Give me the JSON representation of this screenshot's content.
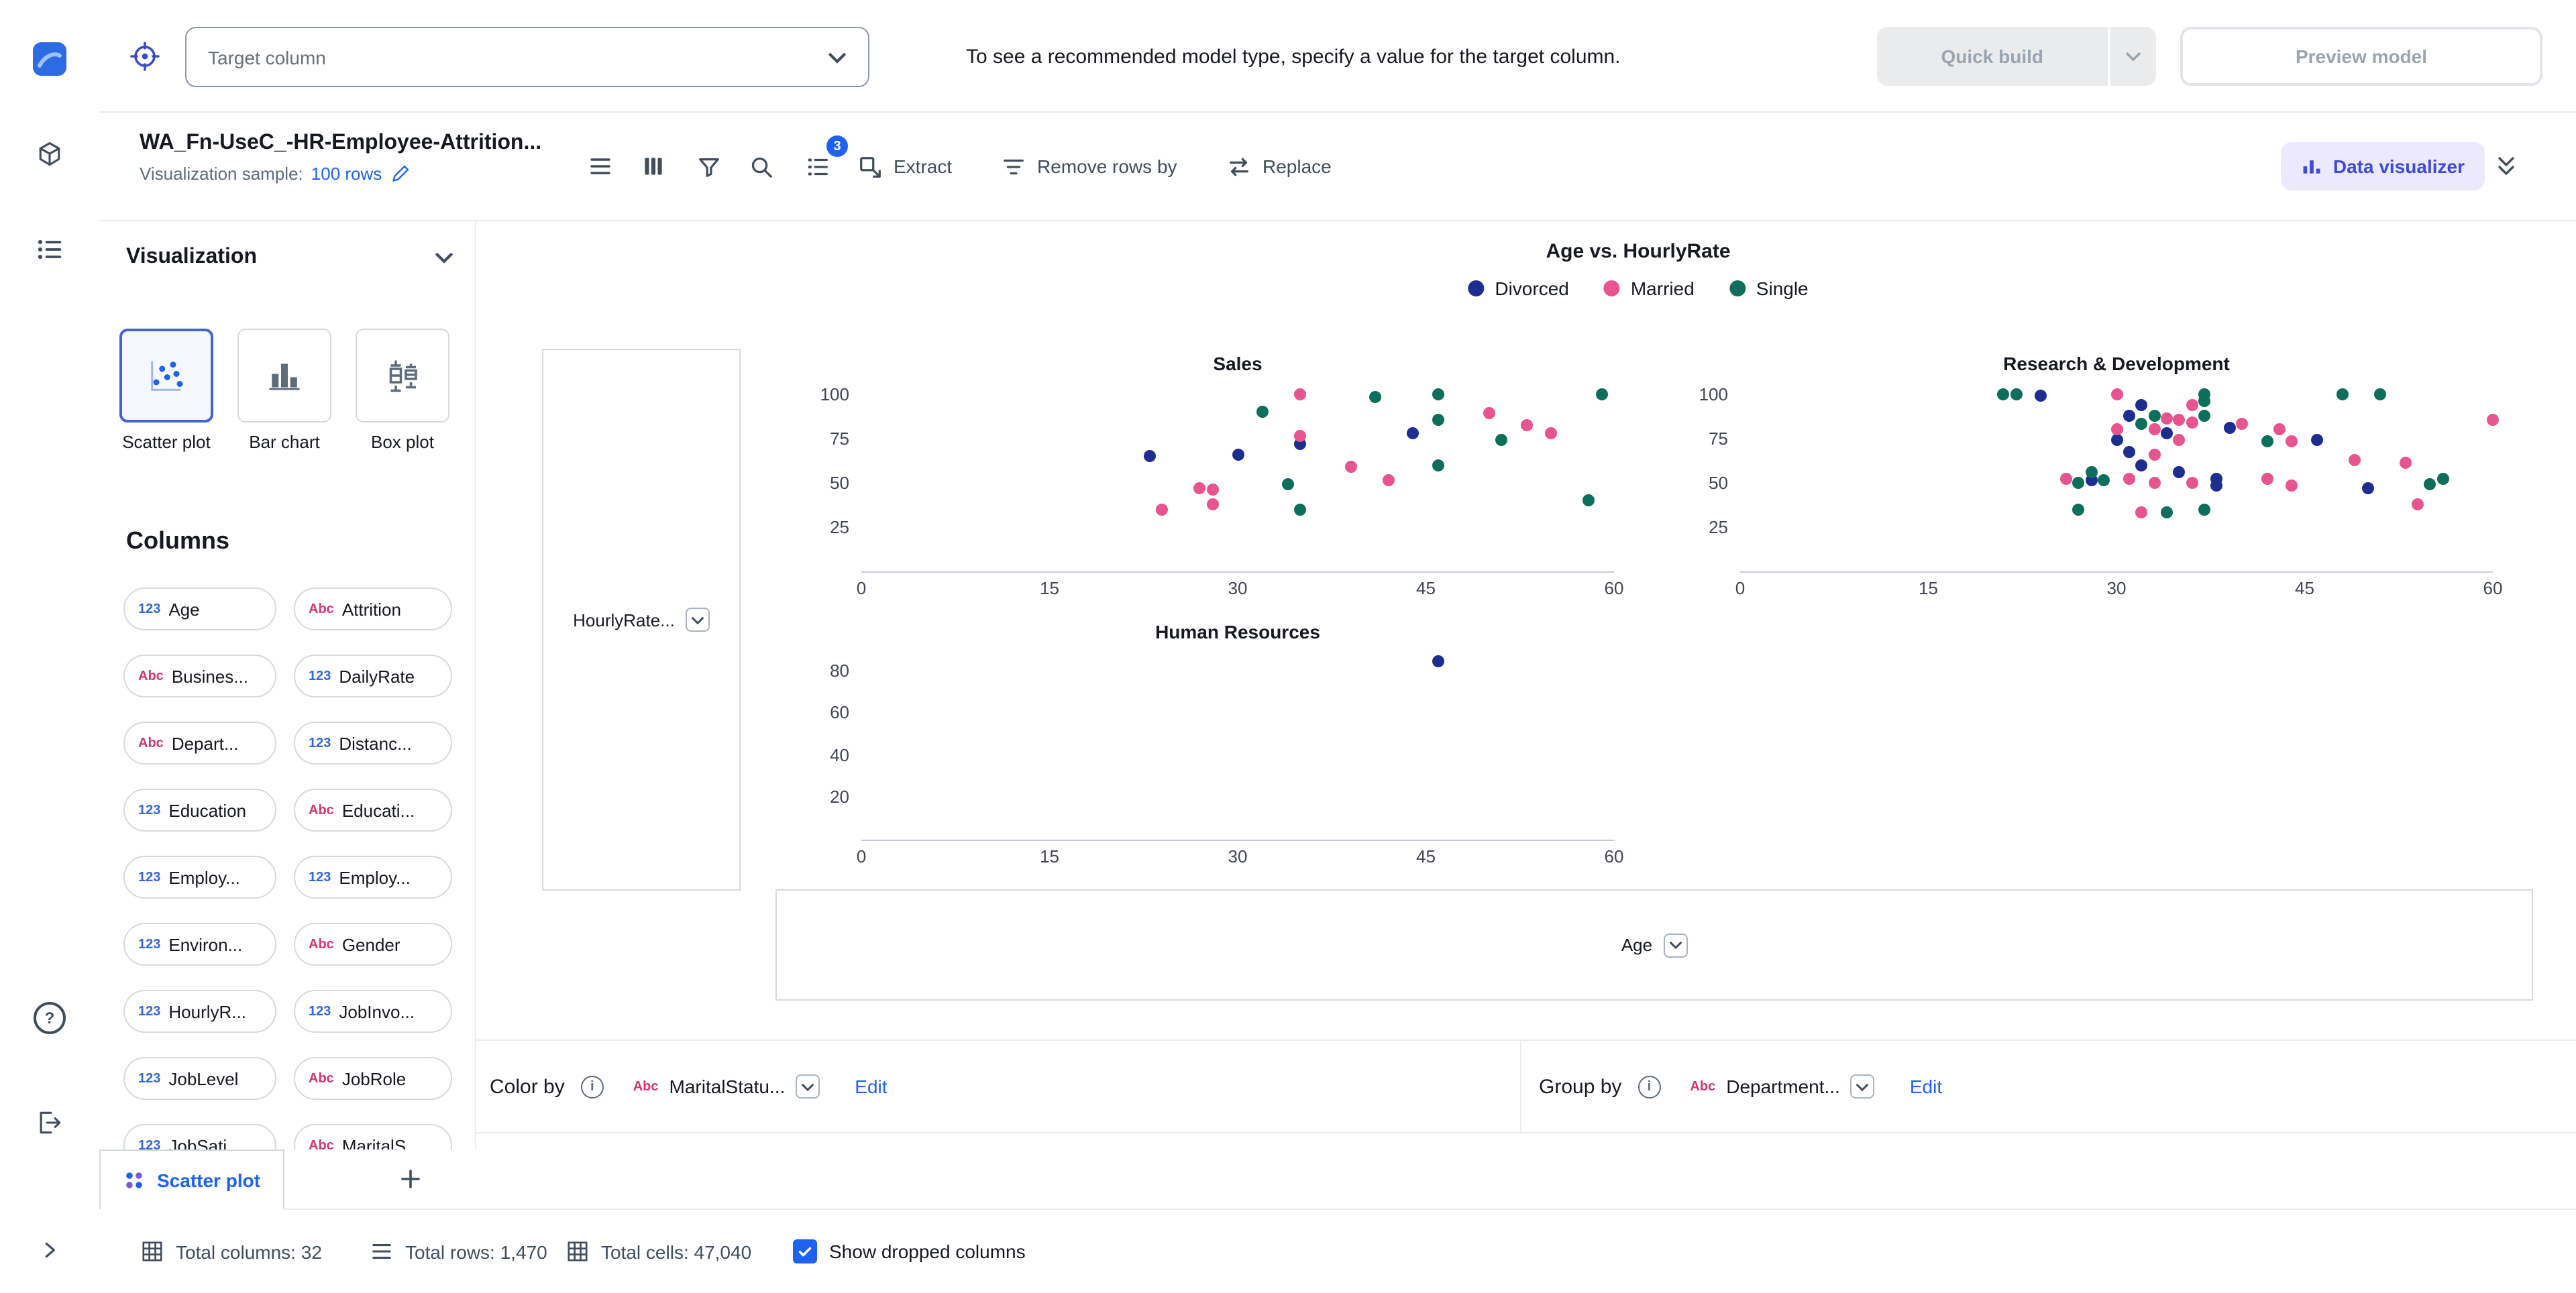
{
  "theme": {
    "accent": "#1d62f0",
    "dv_button_bg": "#ebe9fb",
    "dv_button_text": "#3f4bd8",
    "numeric_badge": "#3366d6",
    "text_badge": "#d13572"
  },
  "icons": {
    "info": "i",
    "help": "?"
  },
  "top_bar": {
    "target_column_placeholder": "Target column",
    "hint": "To see a recommended model type, specify a value for the target column.",
    "quick_build_label": "Quick build",
    "preview_model_label": "Preview model"
  },
  "toolbar": {
    "dataset_title": "WA_Fn-UseC_-HR-Employee-Attrition...",
    "sample_label": "Visualization sample:",
    "sample_value": "100 rows",
    "badge_count": "3",
    "extract_label": "Extract",
    "remove_rows_label": "Remove rows by",
    "replace_label": "Replace",
    "data_visualizer_label": "Data visualizer"
  },
  "viz_panel": {
    "title": "Visualization",
    "chart_types": [
      {
        "label": "Scatter plot",
        "selected": true
      },
      {
        "label": "Bar chart",
        "selected": false
      },
      {
        "label": "Box plot",
        "selected": false
      }
    ],
    "columns_title": "Columns",
    "columns": [
      {
        "type": "123",
        "label": "Age"
      },
      {
        "type": "Abc",
        "label": "Attrition"
      },
      {
        "type": "Abc",
        "label": "Busines..."
      },
      {
        "type": "123",
        "label": "DailyRate"
      },
      {
        "type": "Abc",
        "label": "Depart..."
      },
      {
        "type": "123",
        "label": "Distanc..."
      },
      {
        "type": "123",
        "label": "Education"
      },
      {
        "type": "Abc",
        "label": "Educati..."
      },
      {
        "type": "123",
        "label": "Employ..."
      },
      {
        "type": "123",
        "label": "Employ..."
      },
      {
        "type": "123",
        "label": "Environ..."
      },
      {
        "type": "Abc",
        "label": "Gender"
      },
      {
        "type": "123",
        "label": "HourlyR..."
      },
      {
        "type": "123",
        "label": "JobInvo..."
      },
      {
        "type": "123",
        "label": "JobLevel"
      },
      {
        "type": "Abc",
        "label": "JobRole"
      },
      {
        "type": "123",
        "label": "JobSati..."
      },
      {
        "type": "Abc",
        "label": "MaritalS..."
      }
    ]
  },
  "drop_zones": {
    "y_value": "HourlyRate...",
    "x_value": "Age"
  },
  "controls": {
    "color_by_label": "Color by",
    "color_by_type": "Abc",
    "color_by_value": "MaritalStatu...",
    "group_by_label": "Group by",
    "group_by_type": "Abc",
    "group_by_value": "Department...",
    "edit_label": "Edit"
  },
  "tabs": {
    "active": "Scatter plot"
  },
  "status_bar": {
    "total_columns": "Total columns: 32",
    "total_rows": "Total rows: 1,470",
    "total_cells": "Total cells: 47,040",
    "show_dropped": "Show dropped columns"
  },
  "chart_data": {
    "type": "scatter",
    "title": "Age vs. HourlyRate",
    "xlabel": "Age",
    "ylabel": "HourlyRate",
    "facet_by": "Department",
    "legend": [
      "Divorced",
      "Married",
      "Single"
    ],
    "legend_position": "top-center",
    "grid": false,
    "colors": {
      "Divorced": "#1c2e8f",
      "Married": "#e8548f",
      "Single": "#0d6e5c"
    },
    "subplots": [
      {
        "name": "Sales",
        "x_range": [
          0,
          60
        ],
        "y_render_max": 105,
        "x_ticks": [
          0,
          15,
          30,
          45,
          60
        ],
        "y_ticks": [
          100,
          75,
          50,
          25
        ],
        "series": {
          "Divorced": [
            [
              23,
              65
            ],
            [
              30,
              66
            ],
            [
              35,
              72
            ],
            [
              44,
              78
            ]
          ],
          "Married": [
            [
              24,
              35
            ],
            [
              27,
              47
            ],
            [
              28,
              38
            ],
            [
              28,
              46
            ],
            [
              35,
              76
            ],
            [
              35,
              100
            ],
            [
              39,
              59
            ],
            [
              42,
              51
            ],
            [
              50,
              89
            ],
            [
              53,
              82
            ],
            [
              55,
              78
            ]
          ],
          "Single": [
            [
              32,
              90
            ],
            [
              34,
              49
            ],
            [
              35,
              35
            ],
            [
              41,
              98
            ],
            [
              46,
              85
            ],
            [
              46,
              100
            ],
            [
              46,
              60
            ],
            [
              51,
              74
            ],
            [
              58,
              40
            ],
            [
              59,
              100
            ]
          ]
        }
      },
      {
        "name": "Research & Development",
        "x_range": [
          0,
          60
        ],
        "y_render_max": 105,
        "x_ticks": [
          0,
          15,
          30,
          45,
          60
        ],
        "y_ticks": [
          100,
          75,
          50,
          25
        ],
        "series": {
          "Divorced": [
            [
              24,
              99
            ],
            [
              28,
              51
            ],
            [
              30,
              74
            ],
            [
              31,
              88
            ],
            [
              31,
              67
            ],
            [
              32,
              94
            ],
            [
              32,
              60
            ],
            [
              34,
              78
            ],
            [
              35,
              56
            ],
            [
              38,
              52
            ],
            [
              38,
              48
            ],
            [
              39,
              81
            ],
            [
              46,
              74
            ],
            [
              50,
              47
            ]
          ],
          "Married": [
            [
              26,
              52
            ],
            [
              30,
              100
            ],
            [
              30,
              80
            ],
            [
              31,
              52
            ],
            [
              32,
              33
            ],
            [
              33,
              80
            ],
            [
              33,
              66
            ],
            [
              33,
              50
            ],
            [
              34,
              86
            ],
            [
              35,
              85
            ],
            [
              35,
              74
            ],
            [
              36,
              94
            ],
            [
              36,
              84
            ],
            [
              36,
              50
            ],
            [
              40,
              83
            ],
            [
              42,
              52
            ],
            [
              43,
              80
            ],
            [
              44,
              73
            ],
            [
              44,
              48
            ],
            [
              49,
              63
            ],
            [
              53,
              61
            ],
            [
              54,
              38
            ],
            [
              60,
              85
            ]
          ],
          "Single": [
            [
              21,
              100
            ],
            [
              22,
              100
            ],
            [
              27,
              50
            ],
            [
              27,
              35
            ],
            [
              28,
              56
            ],
            [
              29,
              51
            ],
            [
              32,
              83
            ],
            [
              33,
              88
            ],
            [
              34,
              33
            ],
            [
              37,
              100
            ],
            [
              37,
              96
            ],
            [
              37,
              88
            ],
            [
              37,
              35
            ],
            [
              42,
              73
            ],
            [
              48,
              100
            ],
            [
              51,
              100
            ],
            [
              55,
              49
            ],
            [
              56,
              52
            ]
          ]
        }
      },
      {
        "name": "Human Resources",
        "x_range": [
          0,
          60
        ],
        "y_render_max": 88,
        "x_ticks": [
          0,
          15,
          30,
          45,
          60
        ],
        "y_ticks": [
          80,
          60,
          40,
          20
        ],
        "series": {
          "Divorced": [
            [
              46,
              84
            ]
          ],
          "Married": [],
          "Single": []
        }
      }
    ]
  }
}
